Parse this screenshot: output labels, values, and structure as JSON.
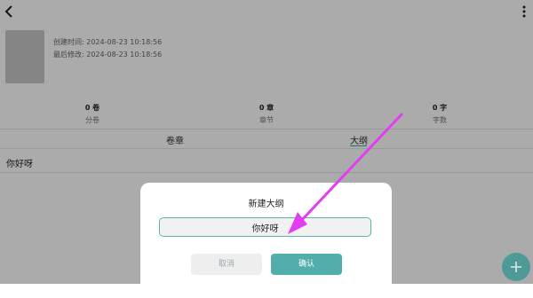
{
  "header": {
    "back_icon": "back-arrow-icon",
    "menu_icon": "more-vert-icon"
  },
  "book": {
    "created_label": "创建时间:",
    "created_value": "2024-08-23 10:18:56",
    "modified_label": "最后修改:",
    "modified_value": "2024-08-23 10:18:56"
  },
  "stats": [
    {
      "value": "0 卷",
      "label": "分卷"
    },
    {
      "value": "0 章",
      "label": "章节"
    },
    {
      "value": "0 字",
      "label": "字数"
    }
  ],
  "tabs": [
    {
      "label": "卷章",
      "active": false
    },
    {
      "label": "大纲",
      "active": true
    }
  ],
  "outline_items": [
    "你好呀"
  ],
  "fab": {
    "icon": "plus-icon"
  },
  "dialog": {
    "title": "新建大纲",
    "input_value": "你好呀",
    "cancel_label": "取消",
    "confirm_label": "确认"
  },
  "colors": {
    "accent": "#52aeaa",
    "overlay": "rgba(0,0,0,0.33)",
    "annotation_arrow": "#e33df0"
  }
}
